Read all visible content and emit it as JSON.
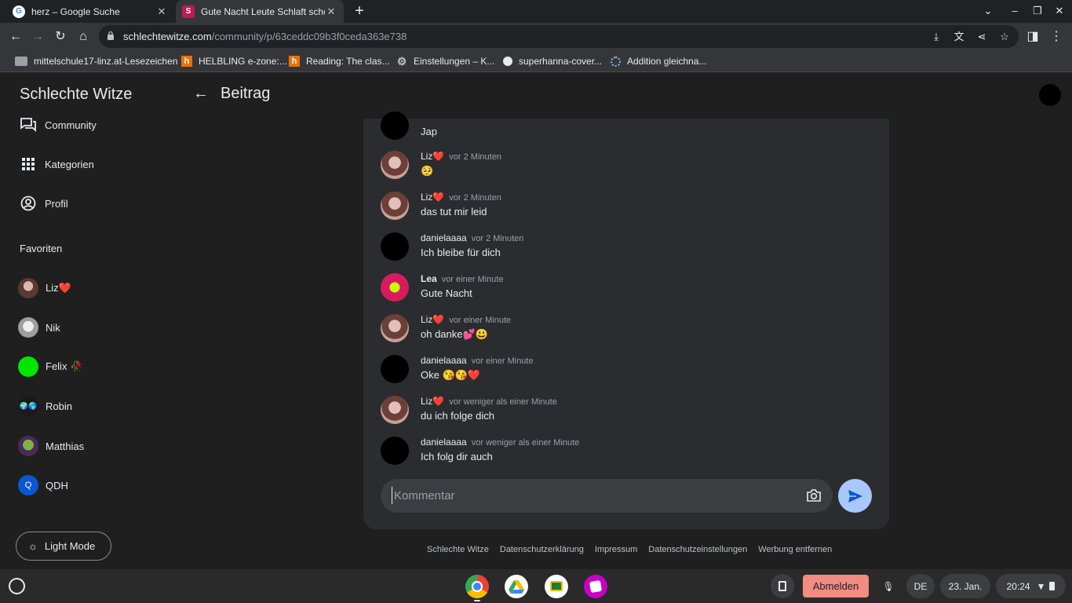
{
  "browser": {
    "tabs": [
      {
        "title": "herz – Google Suche",
        "active": false
      },
      {
        "title": "Gute Nacht Leute Schlaft schön💤",
        "active": true
      }
    ],
    "url_domain": "schlechtewitze.com",
    "url_path": "/community/p/63ceddc09b3f0ceda363e738",
    "bookmarks": [
      "mittelschule17-linz.at-Lesezeichen",
      "HELBLING e-zone:...",
      "Reading: The clas...",
      "Einstellungen – K...",
      "superhanna-cover...",
      "Addition gleichna..."
    ]
  },
  "site": {
    "title": "Schlechte Witze",
    "page_heading": "Beitrag"
  },
  "nav": {
    "items": [
      {
        "label": "Community",
        "icon": "forum-icon"
      },
      {
        "label": "Kategorien",
        "icon": "grid-icon"
      },
      {
        "label": "Profil",
        "icon": "account-icon"
      }
    ],
    "favorites_label": "Favoriten",
    "favorites": [
      {
        "name": "Liz❤️"
      },
      {
        "name": "Nik"
      },
      {
        "name": "Felix 🥀"
      },
      {
        "name": "Robin"
      },
      {
        "name": "Matthias"
      },
      {
        "name": "QDH",
        "initial": "Q"
      }
    ],
    "light_mode_label": "Light Mode"
  },
  "comments": [
    {
      "author": "",
      "time": "",
      "text": "Jap"
    },
    {
      "author": "Liz❤️",
      "time": "vor 2 Minuten",
      "text": "🥺"
    },
    {
      "author": "Liz❤️",
      "time": "vor 2 Minuten",
      "text": "das tut mir leid"
    },
    {
      "author": "danielaaaa",
      "time": "vor 2 Minuten",
      "text": "Ich bleibe für dich"
    },
    {
      "author": "Lea",
      "time": "vor einer Minute",
      "text": "Gute Nacht"
    },
    {
      "author": "Liz❤️",
      "time": "vor einer Minute",
      "text": "oh danke💕😃"
    },
    {
      "author": "danielaaaa",
      "time": "vor einer Minute",
      "text": "Oke 😘😘❤️"
    },
    {
      "author": "Liz❤️",
      "time": "vor weniger als einer Minute",
      "text": "du ich folge dich"
    },
    {
      "author": "danielaaaa",
      "time": "vor weniger als einer Minute",
      "text": "Ich folg dir auch"
    }
  ],
  "comment_input": {
    "placeholder": "Kommentar"
  },
  "footer": [
    "Schlechte Witze",
    "Datenschutzerklärung",
    "Impressum",
    "Datenschutzeinstellungen",
    "Werbung entfernen"
  ],
  "shelf": {
    "logout_label": "Abmelden",
    "lang": "DE",
    "date": "23. Jan.",
    "time": "20:24"
  }
}
